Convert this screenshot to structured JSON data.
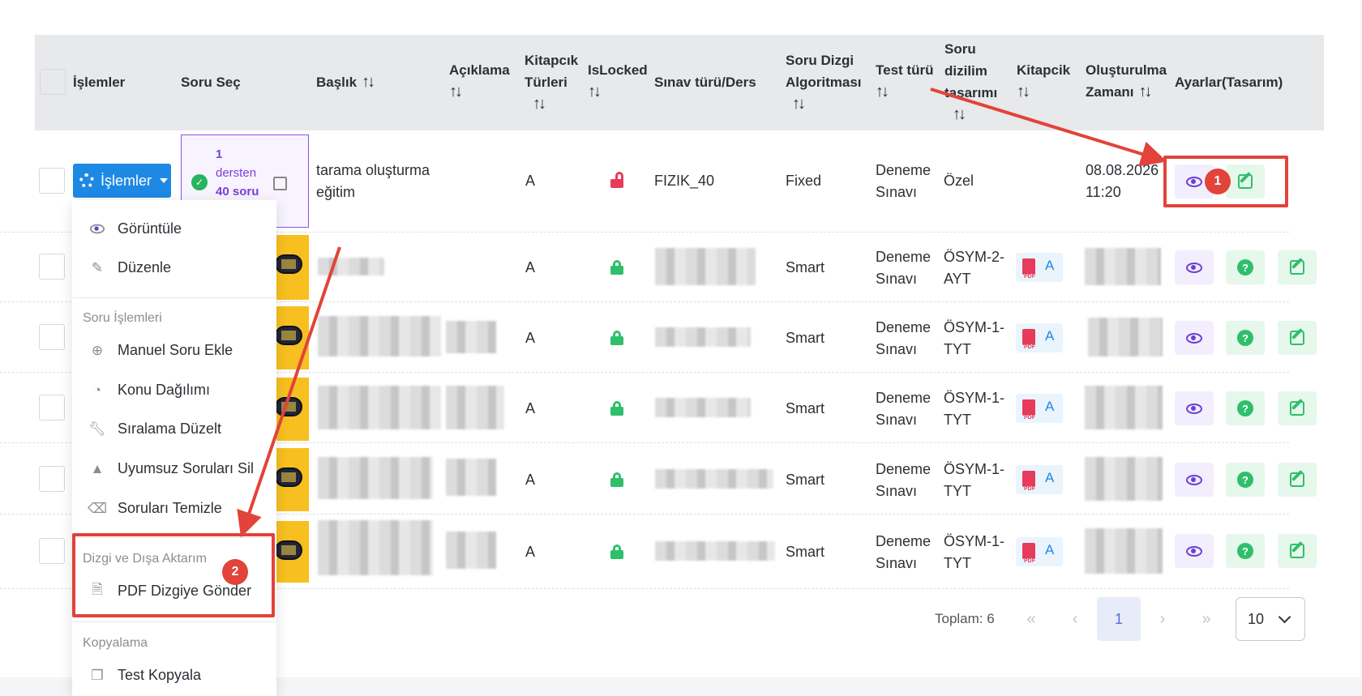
{
  "headers": {
    "islemler": "İşlemler",
    "soru_sec": "Soru Seç",
    "baslik": "Başlık",
    "aciklama": "Açıklama",
    "kitapcik_turleri_1": "Kitapcık",
    "kitapcik_turleri_2": "Türleri",
    "islocked": "IsLocked",
    "sinav_turu": "Sınav türü/Ders",
    "dizgi_1": "Soru Dizgi",
    "dizgi_2": "Algoritması",
    "test_turu": "Test türü",
    "dizilim_1": "Soru",
    "dizilim_2": "dizilim",
    "dizilim_3": "tasarımı",
    "kitapcik": "Kitapcik",
    "olusturulma_1": "Oluşturulma",
    "olusturulma_2": "Zamanı",
    "ayarlar": "Ayarlar(Tasarım)",
    "sort_glyph": "↑↓"
  },
  "first_row": {
    "islemler_button": "İşlemler",
    "soru_sec_lines": [
      "1",
      "dersten",
      "40 soru"
    ],
    "baslik_lines": [
      "tarama oluşturma",
      "eğitim"
    ],
    "kitapcik_turu": "A",
    "sinav": "FIZIK_40",
    "algoritma": "Fixed",
    "test_turu_lines": [
      "Deneme",
      "Sınavı"
    ],
    "dizilim": "Özel",
    "tarih_lines": [
      "08.08.2026",
      "11:20"
    ]
  },
  "rows": [
    {
      "kitapcik_turu": "A",
      "algoritma": "Smart",
      "test_1": "Deneme",
      "test_2": "Sınavı",
      "dizilim_1": "ÖSYM-2-",
      "dizilim_2": "AYT",
      "pdf_a": "A"
    },
    {
      "kitapcik_turu": "A",
      "algoritma": "Smart",
      "test_1": "Deneme",
      "test_2": "Sınavı",
      "dizilim_1": "ÖSYM-1-",
      "dizilim_2": "TYT",
      "pdf_a": "A"
    },
    {
      "kitapcik_turu": "A",
      "algoritma": "Smart",
      "test_1": "Deneme",
      "test_2": "Sınavı",
      "dizilim_1": "ÖSYM-1-",
      "dizilim_2": "TYT",
      "pdf_a": "A"
    },
    {
      "kitapcik_turu": "A",
      "algoritma": "Smart",
      "test_1": "Deneme",
      "test_2": "Sınavı",
      "dizilim_1": "ÖSYM-1-",
      "dizilim_2": "TYT",
      "pdf_a": "A"
    },
    {
      "kitapcik_turu": "A",
      "algoritma": "Smart",
      "test_1": "Deneme",
      "test_2": "Sınavı",
      "dizilim_1": "ÖSYM-1-",
      "dizilim_2": "TYT",
      "pdf_a": "A"
    }
  ],
  "dropdown": {
    "goruntule": "Görüntüle",
    "duzenle": "Düzenle",
    "section_soru": "Soru İşlemleri",
    "manuel": "Manuel Soru Ekle",
    "konu": "Konu Dağılımı",
    "siralama": "Sıralama Düzelt",
    "uyumsuz": "Uyumsuz Soruları Sil",
    "temizle": "Soruları Temizle",
    "section_dizgi": "Dizgi ve Dışa Aktarım",
    "pdf_gonder": "PDF Dizgiye Gönder",
    "section_kopya": "Kopyalama",
    "test_kopyala": "Test Kopyala"
  },
  "annotations": {
    "badge_1": "1",
    "badge_2": "2",
    "color": "#e2433a"
  },
  "pagination": {
    "toplam": "Toplam: 6",
    "first": "«",
    "prev": "‹",
    "current": "1",
    "next": "›",
    "last": "»",
    "per_page": "10"
  }
}
